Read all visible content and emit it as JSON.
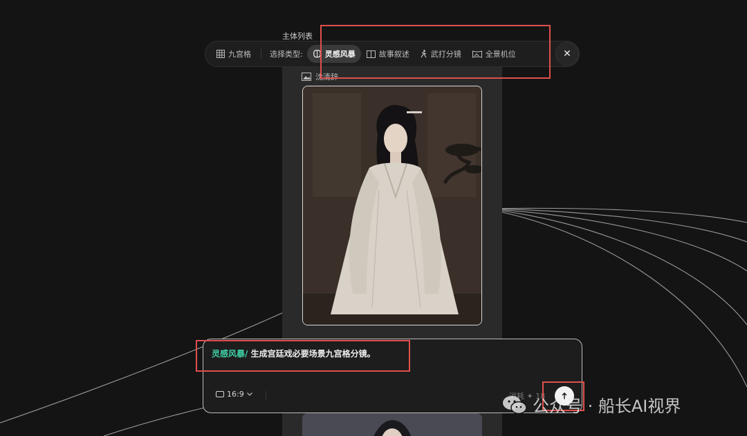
{
  "panel": {
    "title": "主体列表",
    "node_label": "沈清辞"
  },
  "toolbar": {
    "grid_label": "九宫格",
    "select_type_label": "选择类型:",
    "options": [
      {
        "label": "灵感风暴",
        "icon": "brain-icon",
        "active": true
      },
      {
        "label": "故事叙述",
        "icon": "book-icon",
        "active": false
      },
      {
        "label": "武打分镜",
        "icon": "figure-icon",
        "active": false
      },
      {
        "label": "全景机位",
        "icon": "panorama-icon",
        "active": false
      }
    ],
    "close_label": "✕"
  },
  "prompt": {
    "tag": "灵感风暴/",
    "text": "生成宫廷戏必要场景九宫格分镜。",
    "aspect_ratio": "16:9",
    "cost_label": "消耗 ✦ 18"
  },
  "watermark": {
    "text": "公众号 · 船长AI视界"
  },
  "colors": {
    "background": "#141414",
    "accent_tag": "#3fd0a6",
    "highlight": "#e0504e"
  }
}
